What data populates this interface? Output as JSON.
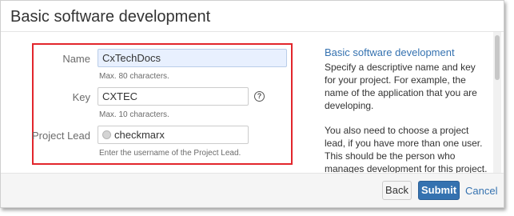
{
  "dialog": {
    "title": "Basic software development"
  },
  "form": {
    "name": {
      "label": "Name",
      "value": "CxTechDocs",
      "hint": "Max. 80 characters."
    },
    "key": {
      "label": "Key",
      "value": "CXTEC",
      "hint": "Max. 10 characters.",
      "help_icon": "?"
    },
    "lead": {
      "label": "Project Lead",
      "value": "checkmarx",
      "hint": "Enter the username of the Project Lead."
    }
  },
  "aside": {
    "title": "Basic software development",
    "p1": "Specify a descriptive name and key for your project. For example, the name of the application that you are developing.",
    "p2": "You also need to choose a project lead, if you have more than one user. This should be the person who manages development for this project."
  },
  "footer": {
    "back_label": "Back",
    "submit_label": "Submit",
    "cancel_label": "Cancel"
  },
  "colors": {
    "accent": "#3572b0",
    "highlight": "#e2262c"
  },
  "icons": {
    "help": "help-icon",
    "avatar": "user-avatar-icon"
  }
}
